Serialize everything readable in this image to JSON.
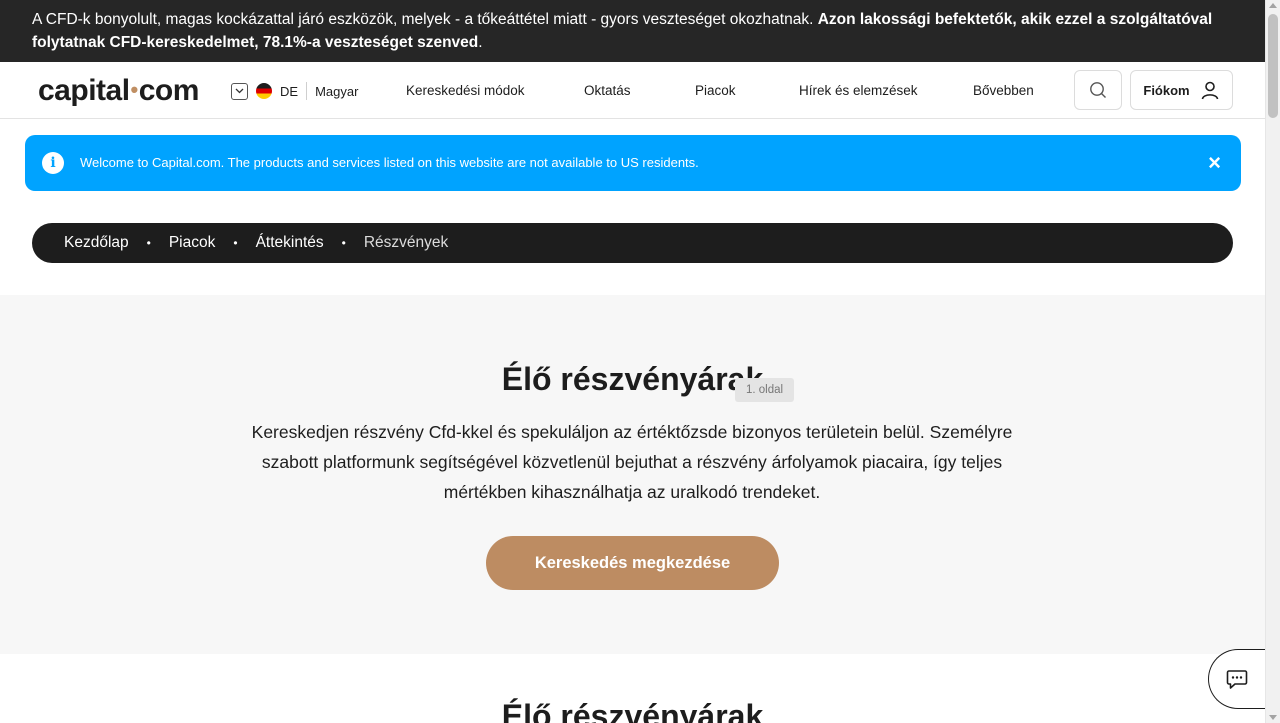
{
  "risk_banner": {
    "text": "A CFD-k bonyolult, magas kockázattal járó eszközök, melyek - a tőkeáttétel miatt - gyors veszteséget okozhatnak. ",
    "bold_text": "Azon lakossági befektetők, akik ezzel a szolgáltatóval folytatnak CFD-kereskedelmet, 78.1%-a veszteséget szenved",
    "end": "."
  },
  "header": {
    "logo_left": "capital",
    "logo_dot": "•",
    "logo_right": "com",
    "country_code": "DE",
    "language": "Magyar",
    "nav": [
      "Kereskedési módok",
      "Oktatás",
      "Piacok",
      "Hírek és elemzések",
      "Bővebben"
    ],
    "account_label": "Fiókom"
  },
  "notice": {
    "text": "Welcome to Capital.com. The products and services listed on this website are not available to US residents.",
    "info_glyph": "i",
    "close_glyph": "×"
  },
  "breadcrumb": {
    "items": [
      "Kezdőlap",
      "Piacok",
      "Áttekintés"
    ],
    "current": "Részvények",
    "separator": "•"
  },
  "hero": {
    "title": "Élő részvényárak",
    "page_badge": "1. oldal",
    "description": "Kereskedjen részvény Cfd-kkel és spekuláljon az értéktőzsde bizonyos területein belül. Személyre szabott platformunk segítségével közvetlenül bejuthat a részvény árfolyamok piacaira, így teljes mértékben kihasználhatja az uralkodó trendeket.",
    "cta_label": "Kereskedés megkezdése"
  },
  "section2": {
    "title": "Élő részvényárak"
  },
  "colors": {
    "banner_bg": "#262626",
    "notice_bg": "#00a3ff",
    "accent_brown": "#bd8c62",
    "breadcrumb_bg": "#1d1d1d"
  },
  "icons": {
    "search": "search-icon",
    "account": "user-icon",
    "chat": "chat-icon",
    "info": "info-icon",
    "close": "close-icon",
    "dropdown": "chevron-down-icon",
    "flag": "germany-flag-icon"
  }
}
